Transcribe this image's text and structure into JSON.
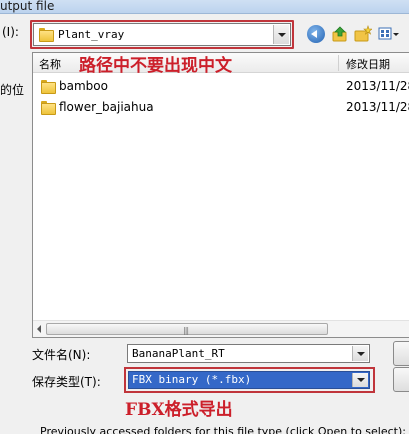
{
  "window": {
    "title": "utput file"
  },
  "lookin": {
    "label": "(I):",
    "value": "Plant_vray"
  },
  "toolbar": {
    "back": "back-icon",
    "up": "up-folder-icon",
    "new_folder": "new-folder-icon",
    "views": "views-menu-icon"
  },
  "places": {
    "label": "的位"
  },
  "filelist": {
    "columns": {
      "name": "名称",
      "date": "修改日期"
    },
    "annotation": "路径中不要出现中文",
    "rows": [
      {
        "name": "bamboo",
        "date": "2013/11/28"
      },
      {
        "name": "flower_bajiahua",
        "date": "2013/11/28"
      }
    ]
  },
  "filename": {
    "label": "文件名(N):",
    "value": "BananaPlant_RT"
  },
  "filetype": {
    "label": "保存类型(T):",
    "value": "FBX binary (*.fbx)",
    "annotation": "FBX格式导出"
  },
  "footer": {
    "previous": "Previously accessed folders for this file type (click Open to select):"
  },
  "colors": {
    "annotation": "#cc1f2a",
    "selection": "#3468c8"
  }
}
